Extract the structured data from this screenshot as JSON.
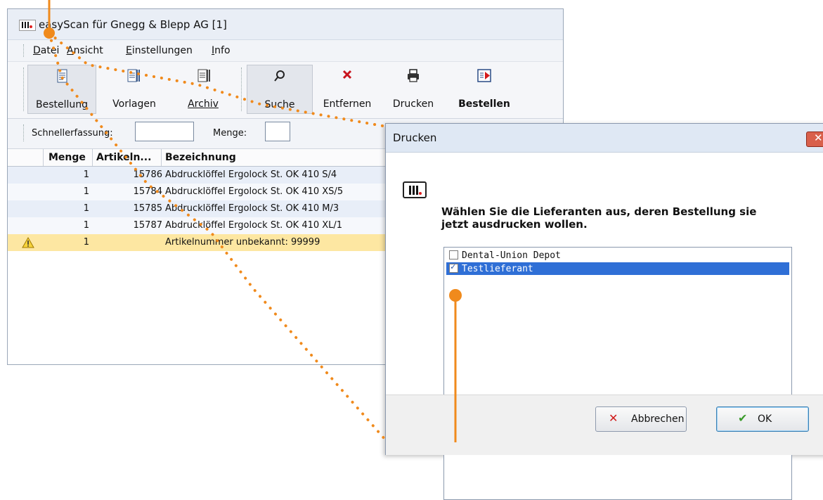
{
  "main_window": {
    "title": "easyScan für Gnegg & Blepp AG [1]",
    "menu": [
      {
        "key": "D",
        "rest": "atei"
      },
      {
        "key": "A",
        "rest": "nsicht"
      },
      {
        "key": "E",
        "rest": "instellungen"
      },
      {
        "key": "I",
        "rest": "nfo"
      }
    ],
    "toolbar_left": [
      {
        "label": "Bestellung",
        "icon": "order-document-icon"
      },
      {
        "label": "Vorlagen",
        "icon": "templates-icon"
      },
      {
        "label": "Archiv",
        "icon": "archive-icon"
      }
    ],
    "toolbar_right": [
      {
        "label": "Suche",
        "icon": "search-icon"
      },
      {
        "label": "Entfernen",
        "icon": "remove-x-icon"
      },
      {
        "label": "Drucken",
        "icon": "printer-icon"
      },
      {
        "label": "Bestellen",
        "icon": "send-order-icon"
      }
    ],
    "quick_entry": {
      "label": "Schnellerfassung:",
      "value": "",
      "quantity_label": "Menge:",
      "quantity_value": ""
    },
    "grid": {
      "columns": [
        "Menge",
        "Artikeln...",
        "Bezeichnung"
      ],
      "rows": [
        {
          "menge": "1",
          "artikel": "15786",
          "bezeichnung": "Abdrucklöffel Ergolock St. OK  410 S/4",
          "warning": false
        },
        {
          "menge": "1",
          "artikel": "15784",
          "bezeichnung": "Abdrucklöffel Ergolock St. OK  410 XS/5",
          "warning": false
        },
        {
          "menge": "1",
          "artikel": "15785",
          "bezeichnung": "Abdrucklöffel Ergolock St. OK 410  M/3",
          "warning": false
        },
        {
          "menge": "1",
          "artikel": "15787",
          "bezeichnung": "Abdrucklöffel Ergolock St. OK 410 XL/1",
          "warning": false
        },
        {
          "menge": "1",
          "artikel": "",
          "bezeichnung": "Artikelnummer unbekannt: 99999",
          "warning": true
        }
      ]
    }
  },
  "dialog": {
    "title": "Drucken",
    "message_line1": "Wählen Sie die Lieferanten aus, deren Bestellung sie",
    "message_line2": "jetzt ausdrucken wollen.",
    "suppliers": [
      {
        "name": "Dental-Union Depot",
        "checked": false,
        "selected": false
      },
      {
        "name": "Testlieferant",
        "checked": true,
        "selected": true
      }
    ],
    "cancel_label": "Abbrechen",
    "ok_label": "OK"
  },
  "colors": {
    "accent_orange": "#f08a1c",
    "row_even": "#e8eef8",
    "warning_row": "#fde7a2",
    "selection_blue": "#2f6fd6"
  }
}
